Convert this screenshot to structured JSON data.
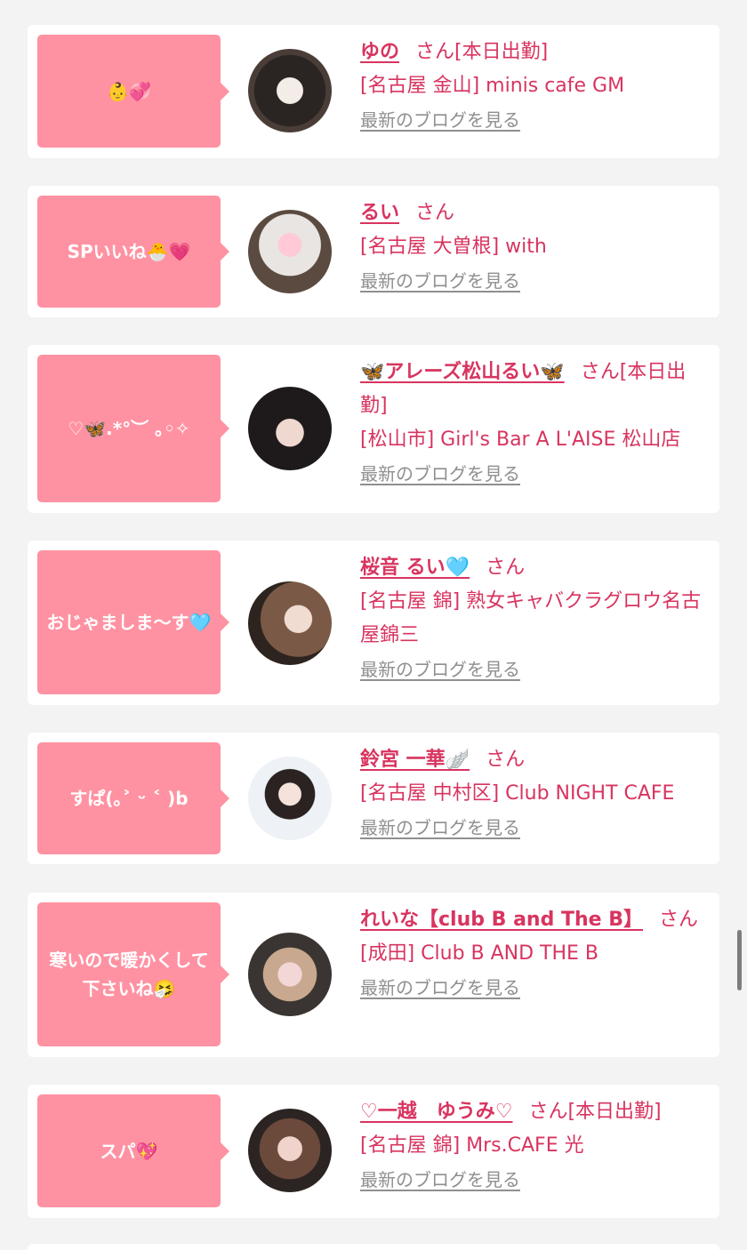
{
  "colors": {
    "bubble": "#ff92a2",
    "accent": "#d8345f",
    "link_gray": "#8f8f8f",
    "page_bg": "#f3f3f3"
  },
  "san_label": "さん",
  "blog_link_label": "最新のブログを見る",
  "cards": [
    {
      "message": "👶💞",
      "name": "ゆの",
      "san_suffix": "さん[本日出勤]",
      "shop": "[名古屋 金山] minis cafe GM",
      "blog": "最新のブログを見る"
    },
    {
      "message": "SPいいね🐣💗",
      "name": "るい",
      "san_suffix": "さん",
      "shop": "[名古屋 大曽根] with",
      "blog": "最新のブログを見る"
    },
    {
      "message": "♡🦋.*°︶ ｡◦✧",
      "name": "🦋アレーズ松山るい🦋",
      "san_suffix": "さん[本日出勤]",
      "shop": "[松山市] Girl's Bar A L'AISE 松山店",
      "blog": "最新のブログを見る"
    },
    {
      "message": "おじゃましま〜す🩵",
      "name": "桜音 るい🩵",
      "san_suffix": "さん",
      "shop": "[名古屋 錦] 熟女キャバクラグロウ名古屋錦三",
      "blog": "最新のブログを見る"
    },
    {
      "message": "すぱ(｡˃ ᵕ ˂ )b",
      "name": "鈴宮 一華🪽",
      "san_suffix": "さん",
      "shop": "[名古屋 中村区] Club NIGHT CAFE",
      "blog": "最新のブログを見る"
    },
    {
      "message": "寒いので暖かくして下さいね🤧",
      "name": "れいな【club B and The B】",
      "san_suffix": "さん",
      "shop": "[成田] Club B AND THE B",
      "blog": "最新のブログを見る"
    },
    {
      "message": "スパ💖",
      "name": "♡一越　ゆうみ♡",
      "san_suffix": "さん[本日出勤]",
      "shop": "[名古屋 錦] Mrs.CAFE 光",
      "blog": "最新のブログを見る"
    }
  ]
}
